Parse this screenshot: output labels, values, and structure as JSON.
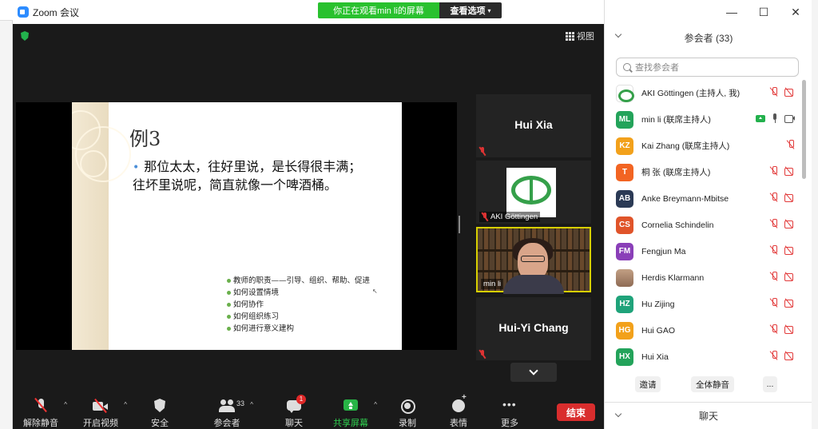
{
  "window": {
    "title": "Zoom 会议"
  },
  "banner": {
    "status": "你正在观看min li的屏幕",
    "options": "查看选项"
  },
  "meeting": {
    "view_label": "视图"
  },
  "slide": {
    "title": "例3",
    "main_line1": "那位太太，往好里说，是长得很丰满；",
    "main_line2": "往坏里说呢，简直就像一个啤酒桶。",
    "list": [
      "教师的职责——引导、组织、帮助、促进",
      "如何设置情境",
      "如何协作",
      "如何组织练习",
      "如何进行意义建构"
    ]
  },
  "tiles": [
    {
      "name": "Hui Xia"
    },
    {
      "name": "AKI Göttingen"
    },
    {
      "name": "min li"
    },
    {
      "name": "Hui-Yi Chang"
    }
  ],
  "toolbar": {
    "unmute": "解除静音",
    "start_video": "开启视频",
    "security": "安全",
    "participants": "参会者",
    "participants_count": "33",
    "chat": "聊天",
    "chat_badge": "1",
    "share": "共享屏幕",
    "record": "录制",
    "reactions": "表情",
    "more": "更多",
    "end": "结束"
  },
  "panel": {
    "title": "参会者 (33)",
    "search_placeholder": "查找参会者",
    "participants": [
      {
        "initials": "",
        "name": "AKI Göttingen (主持人, 我)",
        "color": "#ffffff"
      },
      {
        "initials": "ML",
        "name": "min li (联席主持人)",
        "color": "#23a35a"
      },
      {
        "initials": "KZ",
        "name": "Kai Zhang (联席主持人)",
        "color": "#f2a11b"
      },
      {
        "initials": "T",
        "name": "桐 张 (联席主持人)",
        "color": "#f26422"
      },
      {
        "initials": "AB",
        "name": "Anke Breymann-Mbitse",
        "color": "#2b3a55"
      },
      {
        "initials": "CS",
        "name": "Cornelia Schindelin",
        "color": "#e0542a"
      },
      {
        "initials": "FM",
        "name": "Fengjun Ma",
        "color": "#8a3fb8"
      },
      {
        "initials": "",
        "name": "Herdis Klarmann",
        "color": "#b08a70"
      },
      {
        "initials": "HZ",
        "name": "Hu Zijing",
        "color": "#1fa37a"
      },
      {
        "initials": "HG",
        "name": "Hui GAO",
        "color": "#f2a11b"
      },
      {
        "initials": "HX",
        "name": "Hui Xia",
        "color": "#23a35a"
      }
    ],
    "invite": "邀请",
    "mute_all": "全体静音",
    "more": "...",
    "chat_section": "聊天"
  }
}
